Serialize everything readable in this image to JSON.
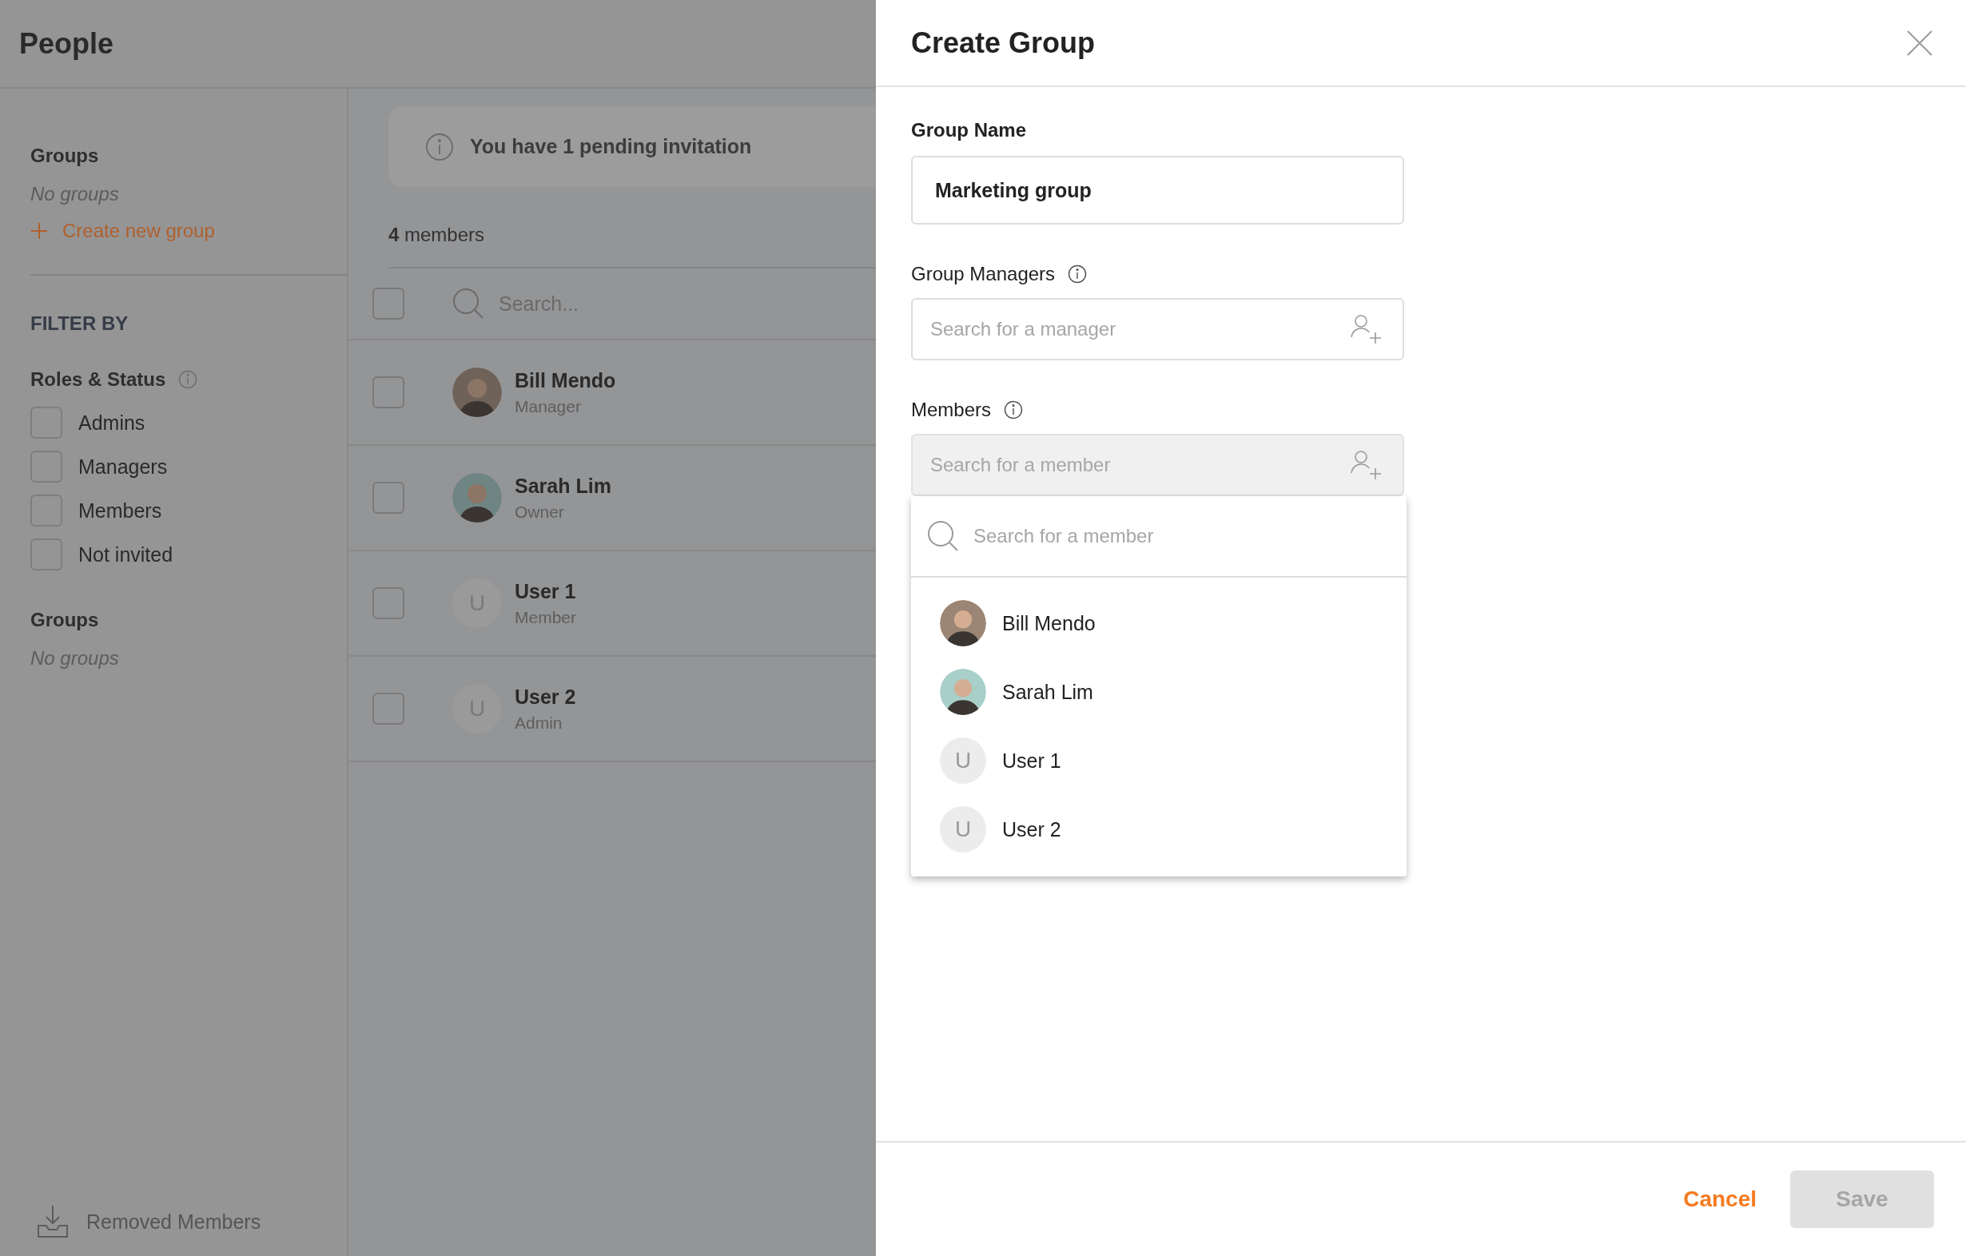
{
  "page": {
    "title": "People"
  },
  "sidebar": {
    "groups_heading": "Groups",
    "groups_empty": "No groups",
    "create_link": "Create new group",
    "filter_heading": "FILTER BY",
    "roles_heading": "Roles & Status",
    "roles": [
      {
        "label": "Admins",
        "checked": false
      },
      {
        "label": "Managers",
        "checked": false
      },
      {
        "label": "Members",
        "checked": false
      },
      {
        "label": "Not invited",
        "checked": false
      }
    ],
    "groups_filter_heading": "Groups",
    "groups_filter_empty": "No groups",
    "removed_link": "Removed Members"
  },
  "notice": "You have 1 pending invitation",
  "member_count": "**4** members",
  "list_search": {
    "placeholder": "Search...",
    "checked": false
  },
  "members": [
    {
      "name": "Bill Mendo",
      "role": "Manager",
      "kind": "photo",
      "color": "#6f6258",
      "checked": false
    },
    {
      "name": "Sarah Lim",
      "role": "Owner",
      "kind": "photo",
      "color": "#6f8584",
      "checked": false
    },
    {
      "name": "User 1",
      "role": "Member",
      "kind": "initial",
      "initial": "U",
      "checked": false
    },
    {
      "name": "User 2",
      "role": "Admin",
      "kind": "initial",
      "initial": "U",
      "checked": false
    }
  ],
  "drawer": {
    "title": "Create Group",
    "group_name": {
      "label": "Group Name",
      "value": "Marketing group"
    },
    "managers": {
      "label": "Group Managers",
      "placeholder": "Search for a manager"
    },
    "members_field": {
      "label": "Members",
      "placeholder": "Search for a member"
    },
    "dropdown": {
      "search_placeholder": "Search for a member",
      "options": [
        {
          "name": "Bill Mendo",
          "kind": "photo",
          "color": "#9b8574"
        },
        {
          "name": "Sarah Lim",
          "kind": "photo",
          "color": "#a9cfc9"
        },
        {
          "name": "User 1",
          "kind": "initial",
          "initial": "U"
        },
        {
          "name": "User 2",
          "kind": "initial",
          "initial": "U"
        }
      ]
    },
    "cancel": "Cancel",
    "save": {
      "label": "Save",
      "disabled": true
    }
  }
}
